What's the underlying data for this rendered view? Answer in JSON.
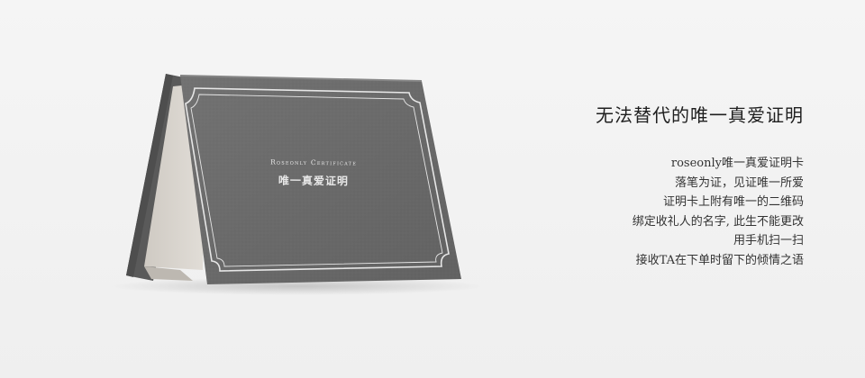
{
  "card": {
    "title_en": "Roseonly Certificate",
    "title_cn": "唯一真爱证明"
  },
  "copy": {
    "headline": "无法替代的唯一真爱证明",
    "lines": [
      "roseonly唯一真爱证明卡",
      "落笔为证，见证唯一所爱",
      "证明卡上附有唯一的二维码",
      "绑定收礼人的名字, 此生不能更改",
      "用手机扫一扫",
      "接收TA在下单时留下的倾情之语"
    ]
  },
  "colors": {
    "background": "#f3f3f3",
    "card_gray": "#6b6b6b",
    "card_inner": "#d9d5cf",
    "frame_line": "#e6e6e6"
  }
}
